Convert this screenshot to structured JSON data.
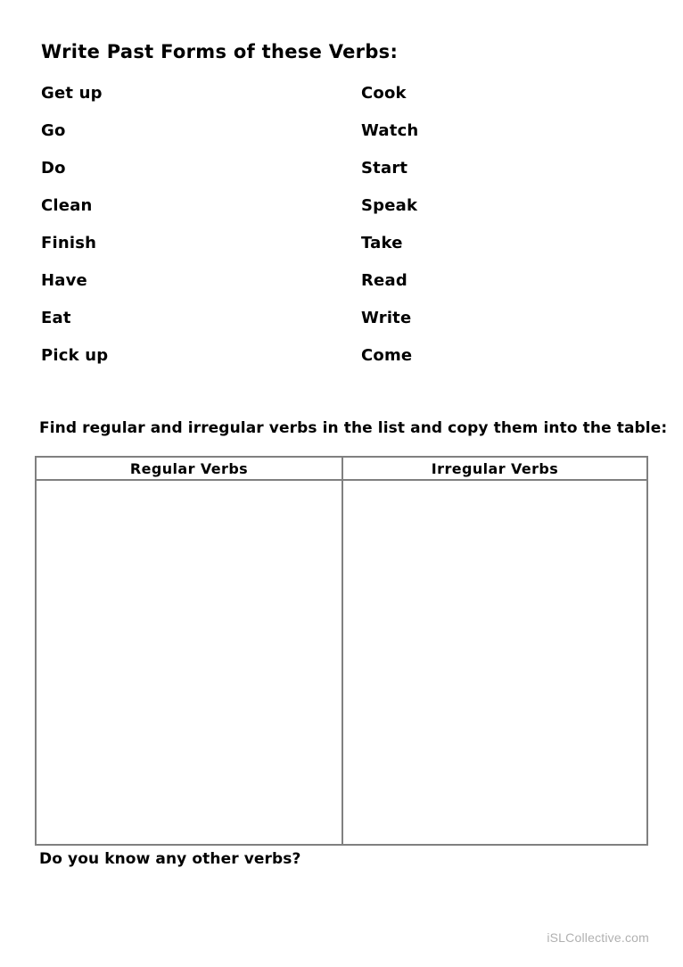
{
  "worksheet": {
    "title": "Write Past Forms of these Verbs:",
    "verb_columns": [
      {
        "name": "left-column",
        "verbs": [
          "Get up",
          "Go",
          "Do",
          "Clean",
          "Finish",
          "Have",
          "Eat",
          "Pick up"
        ]
      },
      {
        "name": "right-column",
        "verbs": [
          "Cook",
          "Watch",
          "Start",
          "Speak",
          "Take",
          "Read",
          "Write",
          "Come"
        ]
      }
    ],
    "table_instruction": "Find regular and irregular verbs in the list and copy them into the table:",
    "table": {
      "headers": [
        "Regular Verbs",
        "Irregular Verbs"
      ],
      "rows": [
        {
          "regular": "",
          "irregular": ""
        }
      ],
      "border_color": "#808080"
    },
    "footer_question": "Do you know any other verbs?",
    "watermark": "iSLCollective.com"
  }
}
